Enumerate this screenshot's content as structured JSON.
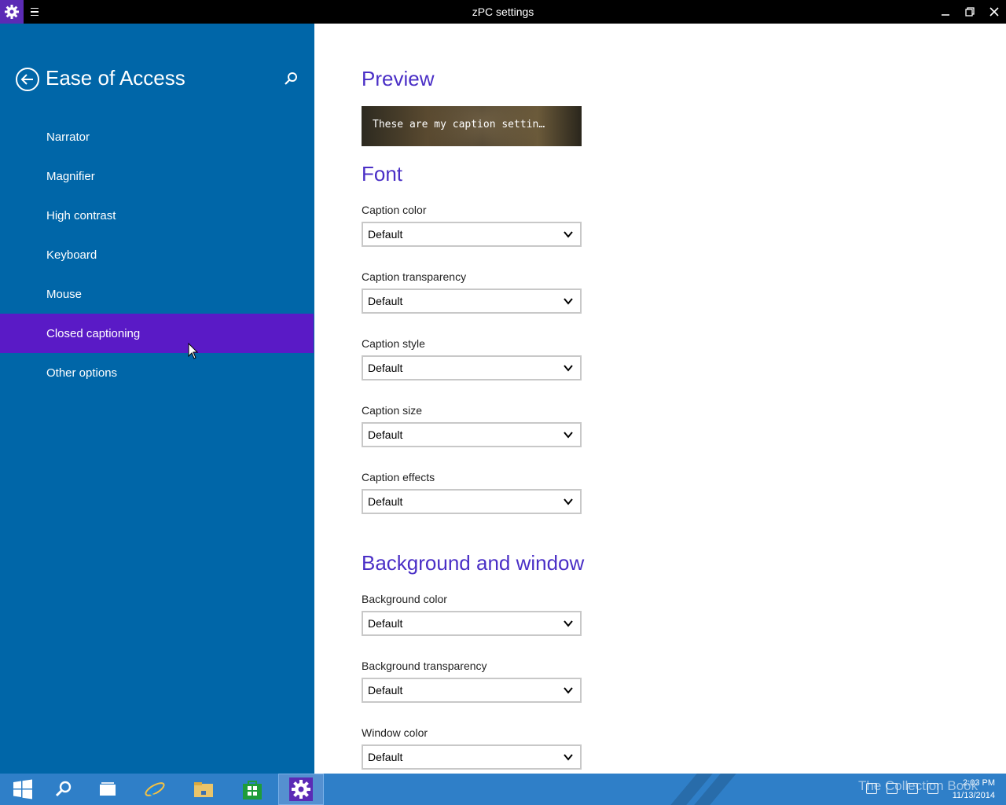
{
  "window": {
    "title": "zPC settings"
  },
  "sidebar": {
    "title": "Ease of Access",
    "items": [
      {
        "label": "Narrator"
      },
      {
        "label": "Magnifier"
      },
      {
        "label": "High contrast"
      },
      {
        "label": "Keyboard"
      },
      {
        "label": "Mouse"
      },
      {
        "label": "Closed captioning",
        "active": true
      },
      {
        "label": "Other options"
      }
    ]
  },
  "main": {
    "preview_heading": "Preview",
    "preview_text": "These are my caption settin…",
    "font_heading": "Font",
    "font_fields": [
      {
        "label": "Caption color",
        "value": "Default"
      },
      {
        "label": "Caption transparency",
        "value": "Default"
      },
      {
        "label": "Caption style",
        "value": "Default"
      },
      {
        "label": "Caption size",
        "value": "Default"
      },
      {
        "label": "Caption effects",
        "value": "Default"
      }
    ],
    "bg_heading": "Background and window",
    "bg_fields": [
      {
        "label": "Background color",
        "value": "Default"
      },
      {
        "label": "Background transparency",
        "value": "Default"
      },
      {
        "label": "Window color",
        "value": "Default"
      }
    ]
  },
  "taskbar": {
    "time": "2:03 PM",
    "date": "11/13/2014",
    "watermark": "The Collection Book"
  },
  "colors": {
    "sidebar": "#0066a8",
    "active_item": "#5a1ac6",
    "heading": "#4a2fc6",
    "taskbar": "#2f7fc8"
  }
}
